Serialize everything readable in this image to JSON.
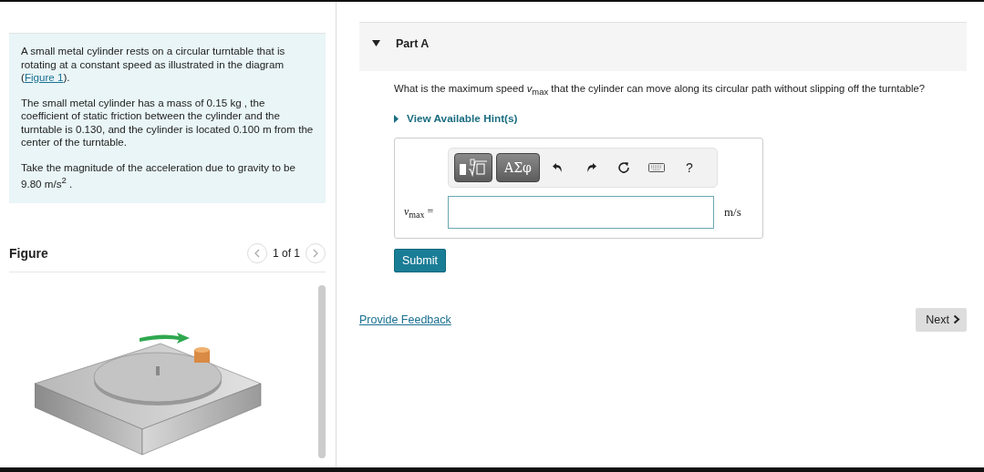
{
  "problem": {
    "paragraphs": [
      {
        "text": "A small metal cylinder rests on a circular turntable that is rotating at a constant speed as illustrated in the diagram (",
        "link": "Figure 1",
        "after": ")."
      },
      {
        "text": "The small metal cylinder has a mass of 0.15 kg , the coefficient of static friction between the cylinder and the turntable is 0.130, and the cylinder is located 0.100 m from the center of the turntable."
      },
      {
        "text": "Take the magnitude of the acceleration due to gravity to be 9.80 m/s$^{2}$ ."
      }
    ]
  },
  "figure": {
    "title": "Figure",
    "pager": "1 of 1"
  },
  "part": {
    "title": "Part A",
    "expanded": true,
    "question": "What is the maximum speed *v*$_{max}$ that the cylinder can move along its circular path without slipping off the turntable?",
    "hint_link": "View Available Hint(s)",
    "toolbar": [
      {
        "kind": "templates"
      },
      {
        "kind": "greek",
        "label": "ΑΣφ"
      },
      {
        "kind": "undo"
      },
      {
        "kind": "redo"
      },
      {
        "kind": "reset"
      },
      {
        "kind": "keyboard"
      },
      {
        "kind": "help",
        "label": "?"
      }
    ],
    "answer": {
      "label": "*v*$_{max}$ =",
      "unit": "m/s"
    },
    "submit": "Submit"
  },
  "feedback": "Provide Feedback",
  "next": "Next"
}
